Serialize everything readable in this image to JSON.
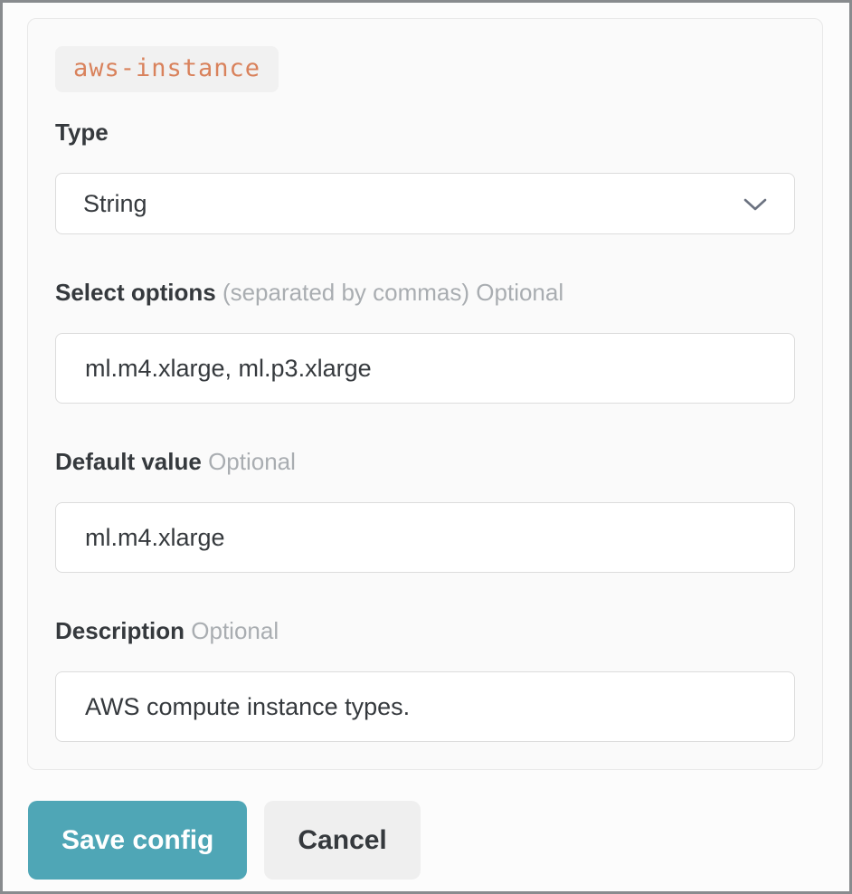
{
  "form": {
    "title": "aws-instance",
    "type_field": {
      "label": "Type",
      "selected_value": "String"
    },
    "select_options_field": {
      "label": "Select options",
      "hint": "(separated by commas)",
      "optional": "Optional",
      "value": "ml.m4.xlarge, ml.p3.xlarge"
    },
    "default_value_field": {
      "label": "Default value",
      "optional": "Optional",
      "value": "ml.m4.xlarge"
    },
    "description_field": {
      "label": "Description",
      "optional": "Optional",
      "value": "AWS compute instance types."
    }
  },
  "actions": {
    "save_label": "Save config",
    "cancel_label": "Cancel"
  },
  "icons": {
    "type_dropdown": "chevron-down-icon"
  },
  "colors": {
    "accent_orange": "#d9825c",
    "accent_teal": "#4fa6b6",
    "text_dark": "#35393d",
    "text_gray": "#a9adb1",
    "cancel_bg": "#efefef"
  }
}
